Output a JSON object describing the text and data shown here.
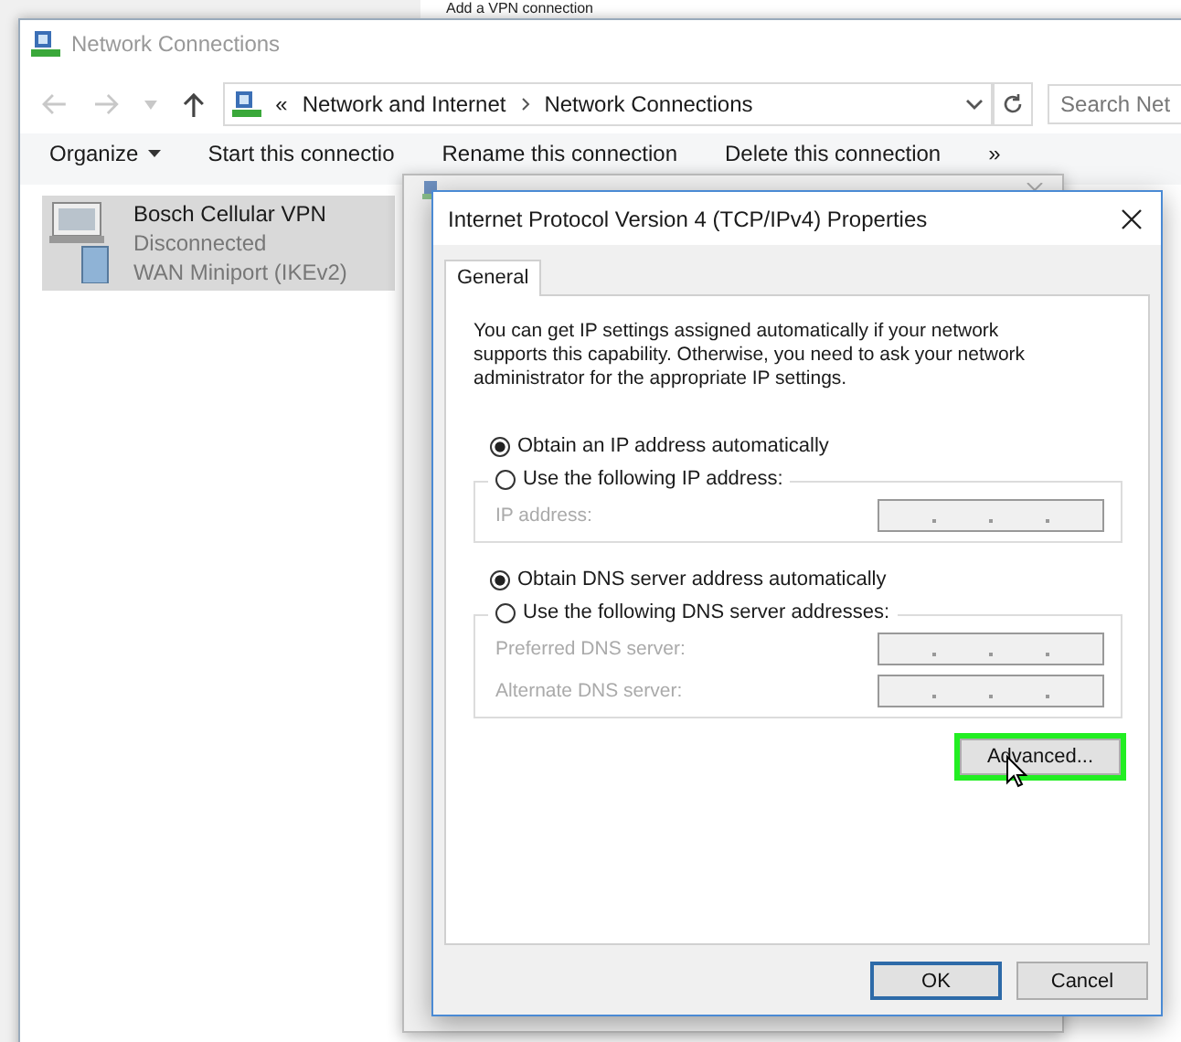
{
  "background_window": {
    "title": "Add a VPN connection"
  },
  "explorer": {
    "title": "Network Connections",
    "path_overflow": "«",
    "breadcrumb": [
      "Network and Internet",
      "Network Connections"
    ],
    "search": {
      "placeholder": "Search Net"
    },
    "toolbar": [
      {
        "label": "Organize",
        "kind": "menu"
      },
      {
        "label": "Start this connectio",
        "kind": "plain"
      },
      {
        "label": "Rename this connection",
        "kind": "plain"
      },
      {
        "label": "Delete this connection",
        "kind": "plain"
      }
    ],
    "toolbar_overflow": "»",
    "connections": [
      {
        "name": "Bosch Cellular VPN",
        "status": "Disconnected",
        "device": "WAN Miniport (IKEv2)",
        "selected": true
      }
    ]
  },
  "dialog": {
    "title": "Internet Protocol Version 4 (TCP/IPv4) Properties",
    "tabs": [
      {
        "label": "General",
        "selected": true
      }
    ],
    "description": "You can get IP settings assigned automatically if your network supports this capability. Otherwise, you need to ask your network administrator for the appropriate IP settings.",
    "ip_options": [
      {
        "label": "Obtain an IP address automatically",
        "selected": true
      },
      {
        "label": "Use the following IP address:",
        "selected": false
      }
    ],
    "ip_fields": [
      {
        "label": "IP address:",
        "disabled": true
      }
    ],
    "dns_options": [
      {
        "label": "Obtain DNS server address automatically",
        "selected": true
      },
      {
        "label": "Use the following DNS server addresses:",
        "selected": false
      }
    ],
    "dns_fields": [
      {
        "label": "Preferred DNS server:",
        "disabled": true
      },
      {
        "label": "Alternate DNS server:",
        "disabled": true
      }
    ],
    "advanced_button": {
      "label": "Advanced...",
      "highlighted": true
    },
    "buttons": [
      {
        "label": "OK",
        "default": true
      },
      {
        "label": "Cancel",
        "default": false
      }
    ]
  }
}
